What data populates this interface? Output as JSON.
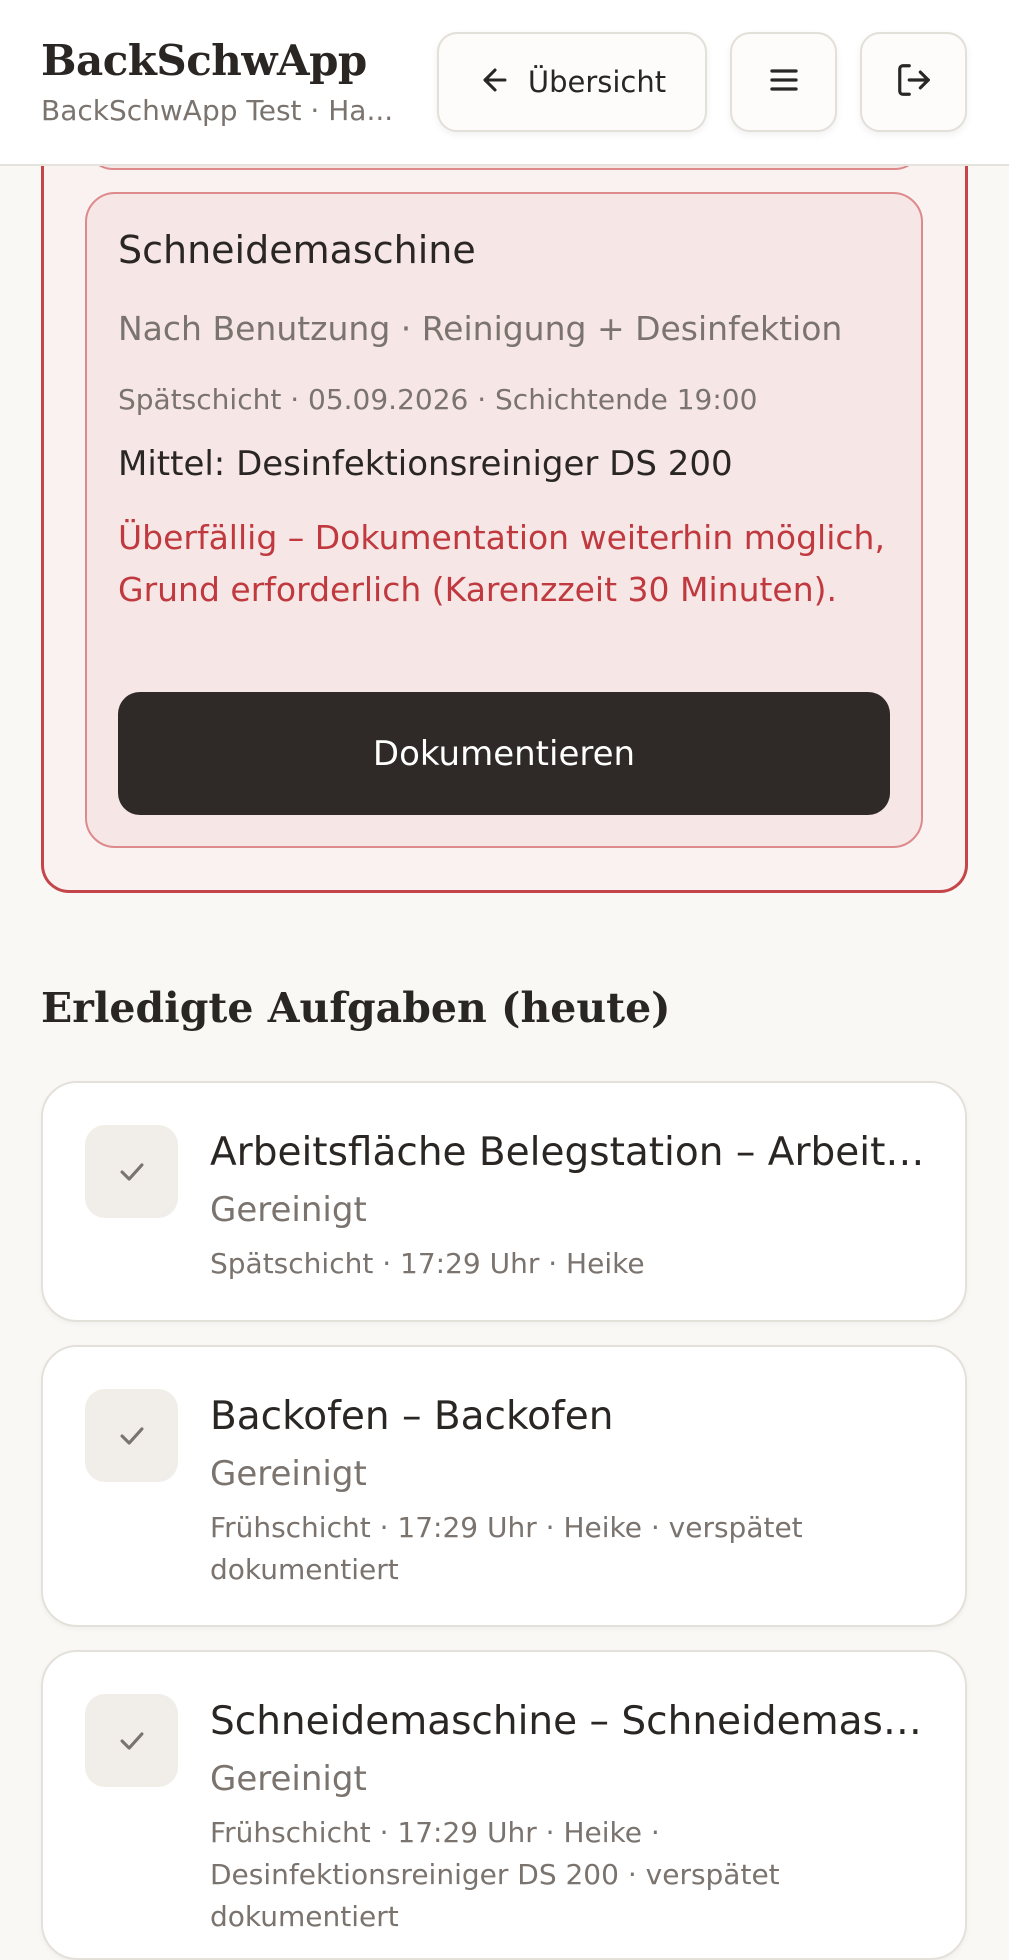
{
  "header": {
    "app_title": "BackSchwApp",
    "app_subtitle": "BackSchwApp Test · Ha...",
    "overview_label": "Übersicht",
    "icons": {
      "back": "arrow-left-icon",
      "menu": "hamburger-menu-icon",
      "logout": "logout-icon"
    }
  },
  "overdue_task": {
    "title": "Schneidemaschine",
    "subtitle": "Nach Benutzung · Reinigung + Desinfektion",
    "meta": "Spätschicht · 05.09.2026 · Schichtende 19:00",
    "agent": "Mittel: Desinfektionsreiniger DS 200",
    "warning": "Überfällig – Dokumentation weiterhin möglich, Grund erforderlich (Karenzzeit 30 Minuten).",
    "button_label": "Dokumentieren"
  },
  "done_section": {
    "title": "Erledigte Aufgaben (heute)",
    "items": [
      {
        "title": "Arbeitsfläche Belegstation – Arbeitsfläche Belegstation",
        "status": "Gereinigt",
        "meta": "Spätschicht · 17:29 Uhr · Heike"
      },
      {
        "title": "Backofen – Backofen",
        "status": "Gereinigt",
        "meta": "Frühschicht · 17:29 Uhr · Heike · verspätet dokumentiert"
      },
      {
        "title": "Schneidemaschine – Schneidemaschine",
        "status": "Gereinigt",
        "meta": "Frühschicht · 17:29 Uhr · Heike · Desinfektionsreiniger DS 200 · verspätet dokumentiert"
      }
    ]
  },
  "colors": {
    "accent_danger": "#c0393f",
    "card_danger_bg": "#f6e7e6",
    "primary_button": "#2f2a28",
    "page_bg": "#faf8f5"
  }
}
